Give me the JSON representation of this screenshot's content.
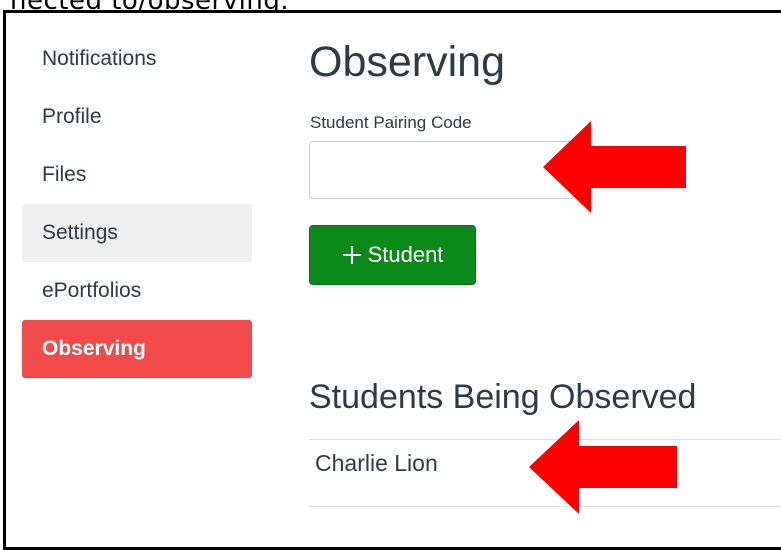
{
  "header_text": "nected to/observing.",
  "sidebar": {
    "items": [
      {
        "label": "Notifications",
        "state": "normal"
      },
      {
        "label": "Profile",
        "state": "normal"
      },
      {
        "label": "Files",
        "state": "normal"
      },
      {
        "label": "Settings",
        "state": "hover"
      },
      {
        "label": "ePortfolios",
        "state": "normal"
      },
      {
        "label": "Observing",
        "state": "active"
      }
    ]
  },
  "main": {
    "title": "Observing",
    "pairing_code_label": "Student Pairing Code",
    "pairing_code_value": "",
    "add_button_label": "Student",
    "students_heading": "Students Being Observed",
    "students": [
      "Charlie Lion"
    ]
  },
  "colors": {
    "active_item": "#f24a4a",
    "add_button": "#0b8a1a",
    "annotation_arrow": "#ff0000"
  },
  "icons": {
    "add_button": "plus-icon",
    "annotations": "left-arrow-icon"
  }
}
